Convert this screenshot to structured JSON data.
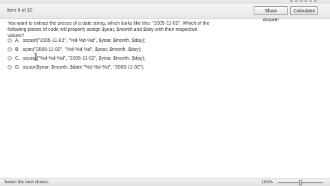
{
  "header": {
    "item_label": "Item 6 of 10",
    "show_answer_label": "Show Answer",
    "calculator_label": "Calculator"
  },
  "question": {
    "text": "You want to extract the pieces of a date string, which looks like this: \"2005-11-02\". Which of the following pieces of code will properly assign $year, $month and $day with their respective values?"
  },
  "options": [
    {
      "letter": "A.",
      "text": "sscanf(\"2005-11-02\", \"%d-%d-%d\", $year, $month, $day);"
    },
    {
      "letter": "B.",
      "text": "scan(\"2005-11-02\", \"%d-%d-%d\", $year, $month, $day);"
    },
    {
      "letter": "C.",
      "text": "sscanf(\"%d-%d-%d\", \"2005-11-02\", $year, $month, $day);"
    },
    {
      "letter": "D.",
      "text": "sscan($year, $month, $date \"%d-%d-%d\", \"2005-11-02\");"
    }
  ],
  "status": {
    "text": "Select the best choice.",
    "zoom": "100%",
    "zoom_level_fraction": 0.5
  },
  "icons": {
    "cursor": "text-cursor-icon",
    "radio": "radio-button-icon"
  }
}
